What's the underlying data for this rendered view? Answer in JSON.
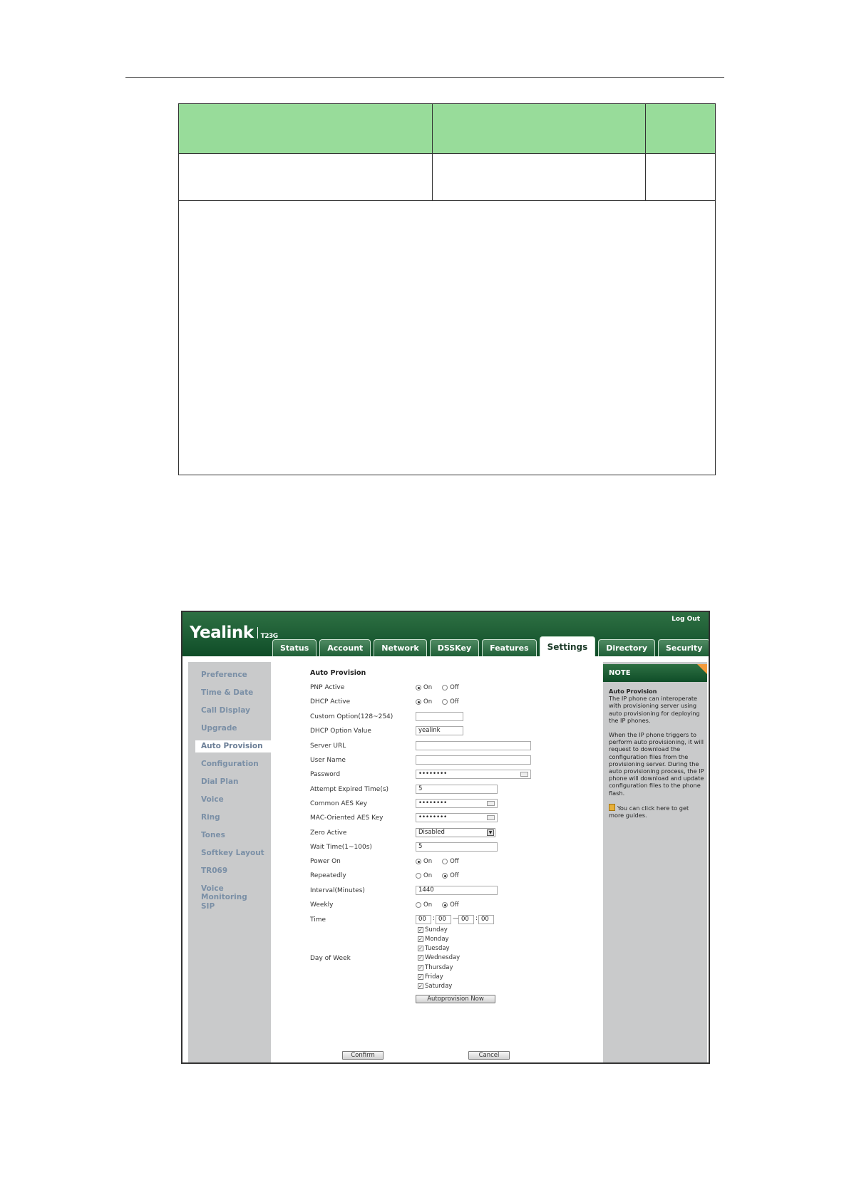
{
  "screenshot": {
    "brand": "Yealink",
    "model": "T23G",
    "logout": "Log Out",
    "tabs": [
      {
        "label": "Status"
      },
      {
        "label": "Account"
      },
      {
        "label": "Network"
      },
      {
        "label": "DSSKey"
      },
      {
        "label": "Features"
      },
      {
        "label": "Settings",
        "active": true
      },
      {
        "label": "Directory"
      },
      {
        "label": "Security"
      }
    ],
    "sidebar": [
      "Preference",
      "Time & Date",
      "Call Display",
      "Upgrade",
      "Auto Provision",
      "Configuration",
      "Dial Plan",
      "Voice",
      "Ring",
      "Tones",
      "Softkey Layout",
      "TR069",
      "Voice Monitoring",
      "SIP"
    ],
    "section_title": "Auto Provision",
    "labels": {
      "pnp": "PNP Active",
      "dhcp": "DHCP Active",
      "custom_option": "Custom Option(128~254)",
      "dhcp_value": "DHCP Option Value",
      "server_url": "Server URL",
      "user_name": "User Name",
      "password": "Password",
      "attempt": "Attempt Expired Time(s)",
      "common_aes": "Common AES Key",
      "mac_aes": "MAC-Oriented AES Key",
      "zero": "Zero Active",
      "wait": "Wait Time(1~100s)",
      "power_on": "Power On",
      "repeatedly": "Repeatedly",
      "interval": "Interval(Minutes)",
      "weekly": "Weekly",
      "time": "Time",
      "day_of_week": "Day of Week"
    },
    "radio": {
      "on": "On",
      "off": "Off"
    },
    "values": {
      "dhcp_value": "yealink",
      "password": "••••••••",
      "attempt": "5",
      "common_aes": "••••••••",
      "mac_aes": "••••••••",
      "zero": "Disabled",
      "wait": "5",
      "interval": "1440",
      "time": [
        "00",
        "00",
        "00",
        "00"
      ]
    },
    "time_sep": {
      "colon": ":",
      "dash": "—"
    },
    "days": [
      "Sunday",
      "Monday",
      "Tuesday",
      "Wednesday",
      "Thursday",
      "Friday",
      "Saturday"
    ],
    "check_mark": "✓",
    "buttons": {
      "autoprovision": "Autoprovision Now",
      "confirm": "Confirm",
      "cancel": "Cancel"
    },
    "note": {
      "header": "NOTE",
      "title": "Auto Provision",
      "p1": "The IP phone can interoperate with provisioning server using auto provisioning for deploying the IP phones.",
      "p2": "When the IP phone triggers to perform auto provisioning, it will request to download the configuration files from the provisioning server. During the auto provisioning process, the IP phone will download and update configuration files to the phone flash.",
      "guide": "You can click here to get more guides."
    }
  }
}
